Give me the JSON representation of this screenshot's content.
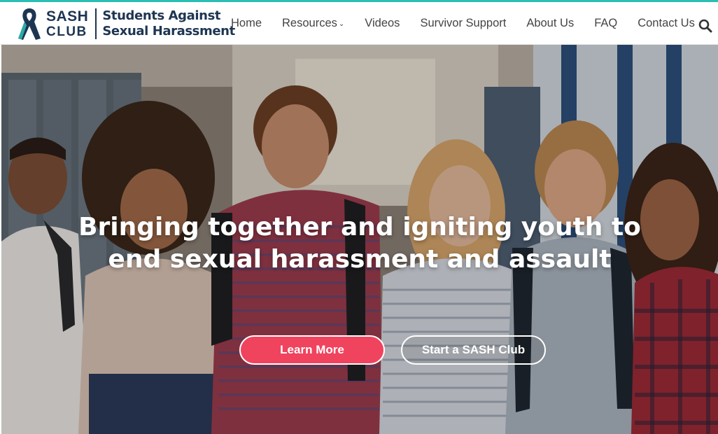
{
  "brand": {
    "sash": "SASH",
    "club": "CLUB",
    "line1": "Students Against",
    "line2": "Sexual Harassment",
    "ribbon_color": "#1e3552",
    "accent_color": "#2bbfb3"
  },
  "nav": {
    "items": [
      {
        "label": "Home"
      },
      {
        "label": "Resources",
        "has_dropdown": true
      },
      {
        "label": "Videos"
      },
      {
        "label": "Survivor Support"
      },
      {
        "label": "About Us"
      },
      {
        "label": "FAQ"
      },
      {
        "label": "Contact Us"
      }
    ],
    "search_icon": "search-icon"
  },
  "hero": {
    "headline_line1": "Bringing together and igniting youth to",
    "headline_line2": "end sexual harassment and assault",
    "primary_button": "Learn More",
    "secondary_button": "Start a SASH Club",
    "primary_color": "#f0435e"
  }
}
